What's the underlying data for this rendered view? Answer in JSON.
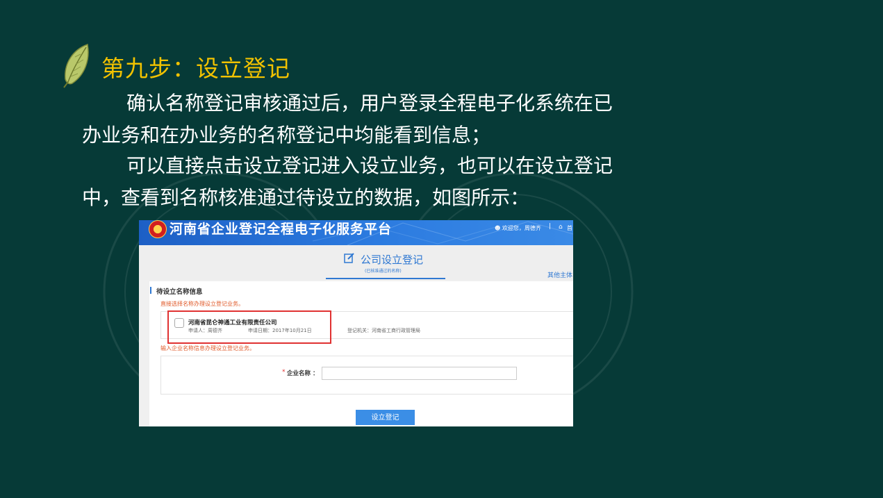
{
  "slide": {
    "title": "第九步：设立登记",
    "para1_line1": "确认名称登记审核通过后，用户登录全程电子化系统在已",
    "para1_line2": "办业务和在办业务的名称登记中均能看到信息；",
    "para2_line1": "可以直接点击设立登记进入设立业务，也可以在设立登记",
    "para2_line2": "中，查看到名称核准通过待设立的数据，如图所示："
  },
  "screenshot": {
    "header": {
      "site_title": "河南省企业登记全程电子化服务平台",
      "welcome": "欢迎您，周德齐",
      "separator": "|",
      "home_label": "首"
    },
    "tab": {
      "title": "公司设立登记",
      "subtitle": "(已核准通过的名称)",
      "other": "其他主体"
    },
    "pending": {
      "section_title": "待设立名称信息",
      "hint": "直接选择名称办理设立登记业务。",
      "company_name": "河南省昆仑神通工业有限责任公司",
      "applicant": "申请人：周德齐",
      "apply_date": "申请日期：2017年10月21日",
      "authority": "登记机关：河南省工商行政管理局"
    },
    "form": {
      "hint": "输入企业名称信息办理设立登记业务。",
      "required_mark": "*",
      "field_label": "企业名称 ：",
      "field_value": "",
      "submit_label": "设立登记"
    }
  },
  "colors": {
    "background": "#063a37",
    "title": "#f2c200",
    "text": "#ffffff",
    "header_blue": "#1d5fc5",
    "accent_blue": "#2f78d2",
    "hint_orange": "#e05a2a",
    "highlight_red": "#e03131"
  },
  "icons": {
    "slide_bullet": "leaf-icon",
    "tab": "edit-icon",
    "user": "user-icon",
    "home": "home-icon",
    "emblem": "emblem-icon"
  }
}
